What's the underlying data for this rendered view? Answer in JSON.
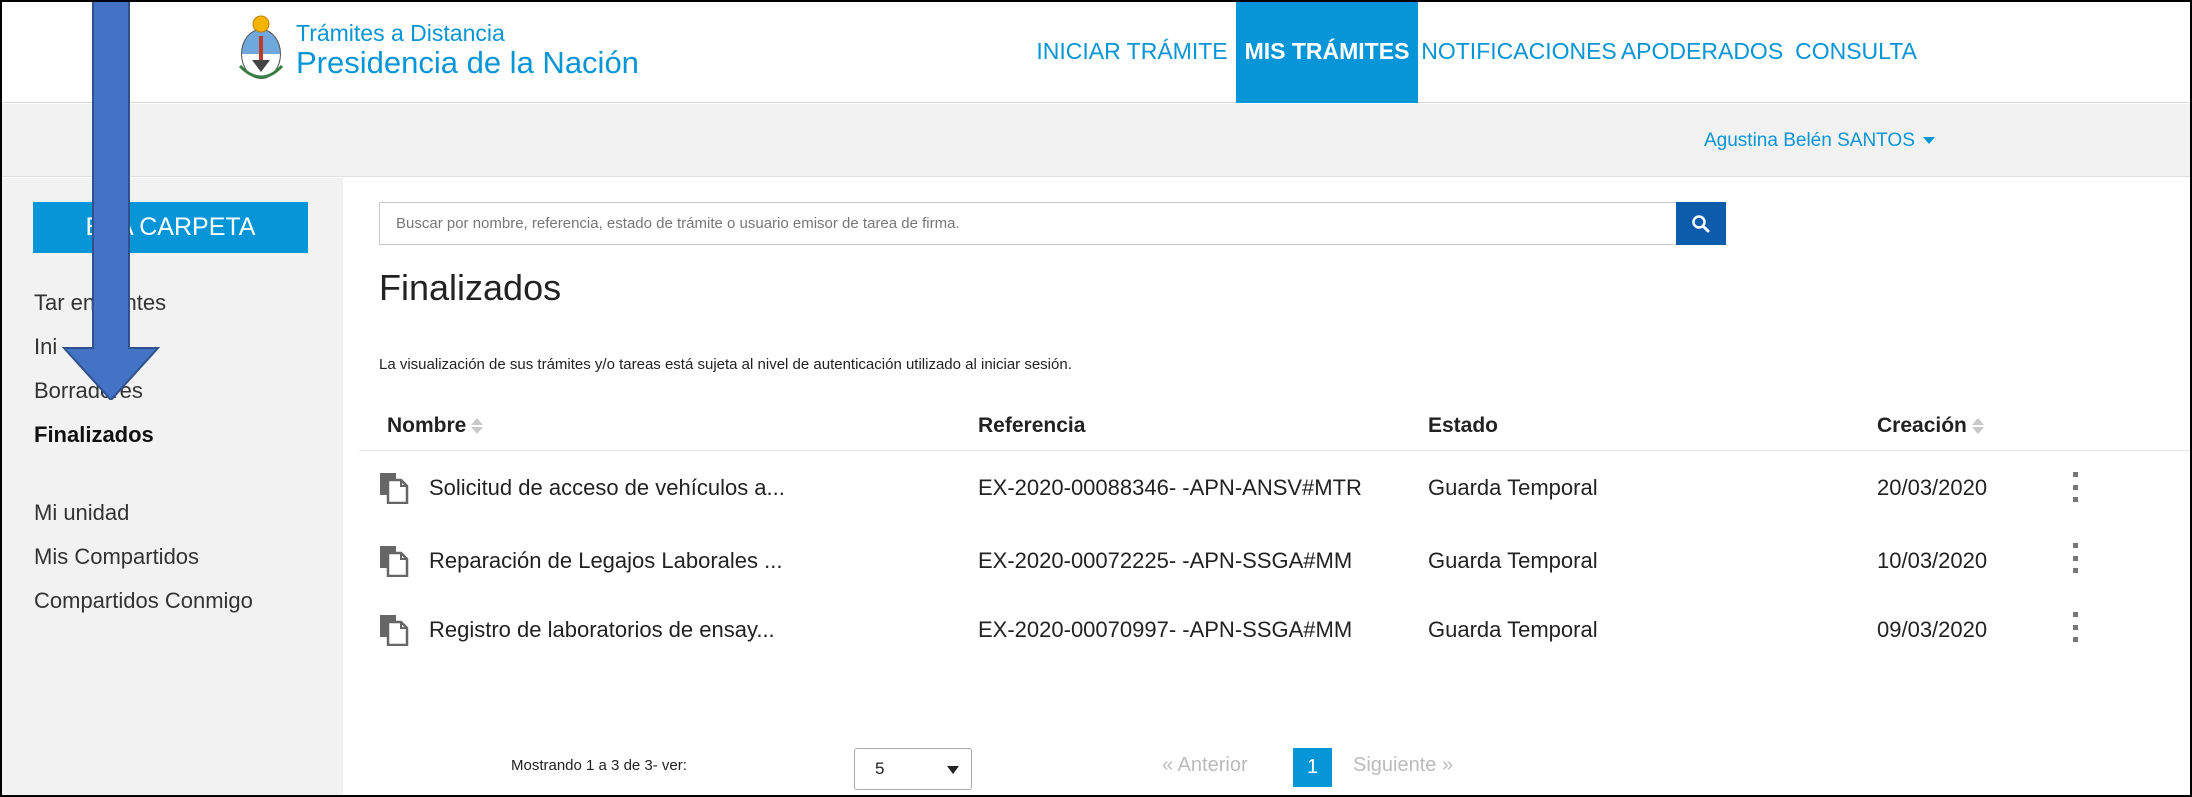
{
  "header": {
    "brand_line1": "Trámites a Distancia",
    "brand_line2": "Presidencia de la Nación",
    "nav": [
      {
        "label": "INICIAR TRÁMITE",
        "active": false
      },
      {
        "label": "MIS TRÁMITES",
        "active": true
      },
      {
        "label": "NOTIFICACIONES",
        "active": false
      },
      {
        "label": "APODERADOS",
        "active": false
      },
      {
        "label": "CONSULTA",
        "active": false
      }
    ],
    "user_name": "Agustina Belén SANTOS"
  },
  "sidebar": {
    "new_folder_label": "EVA CARPETA",
    "items": [
      {
        "label": "Tar        endientes"
      },
      {
        "label": "Ini"
      },
      {
        "label": "Borradores"
      },
      {
        "label": "Finalizados",
        "active": true
      },
      {
        "label": "Mi unidad"
      },
      {
        "label": "Mis Compartidos"
      },
      {
        "label": "Compartidos Conmigo"
      }
    ]
  },
  "search": {
    "placeholder": "Buscar por nombre, referencia, estado de trámite o usuario emisor de tarea de firma.",
    "icon": "search-icon"
  },
  "main": {
    "title": "Finalizados",
    "notice": "La visualización de sus trámites y/o tareas está sujeta al nivel de autenticación utilizado al iniciar sesión."
  },
  "table": {
    "columns": [
      "Nombre",
      "Referencia",
      "Estado",
      "Creación"
    ],
    "rows": [
      {
        "name": "Solicitud de acceso de vehículos a...",
        "ref": "EX-2020-00088346- -APN-ANSV#MTR",
        "status": "Guarda Temporal",
        "date": "20/03/2020"
      },
      {
        "name": "Reparación de Legajos Laborales ...",
        "ref": "EX-2020-00072225- -APN-SSGA#MM",
        "status": "Guarda Temporal",
        "date": "10/03/2020"
      },
      {
        "name": "Registro de laboratorios de ensay...",
        "ref": "EX-2020-00070997- -APN-SSGA#MM",
        "status": "Guarda Temporal",
        "date": "09/03/2020"
      }
    ]
  },
  "pagination": {
    "showing": "Mostrando 1 a 3 de 3- ver:",
    "page_size": "5",
    "prev": "«  Anterior",
    "current_page": "1",
    "next": "Siguiente  »"
  },
  "colors": {
    "primary": "#0695d6",
    "search_button": "#0d5cab",
    "sidebar_bg": "#f2f2f2",
    "annotation_arrow": "#4472c4"
  }
}
